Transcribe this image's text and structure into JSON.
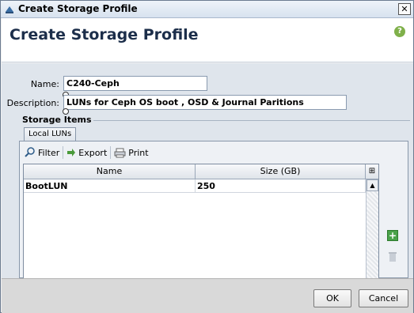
{
  "window": {
    "title": "Create Storage Profile",
    "close_glyph": "✕"
  },
  "header": {
    "title": "Create Storage Profile",
    "help_glyph": "?"
  },
  "form": {
    "name_label": "Name:",
    "name_value": "C240-Ceph",
    "description_label": "Description:",
    "description_value": "LUNs for Ceph OS boot , OSD & Journal Paritions"
  },
  "storage_items": {
    "legend": "Storage Items",
    "tab": "Local LUNs",
    "toolbar": {
      "filter": "Filter",
      "export": "Export",
      "print": "Print"
    },
    "columns": [
      "Name",
      "Size (GB)"
    ],
    "rows": [
      {
        "name": "BootLUN",
        "size": "250"
      }
    ]
  },
  "buttons": {
    "ok": "OK",
    "cancel": "Cancel"
  }
}
